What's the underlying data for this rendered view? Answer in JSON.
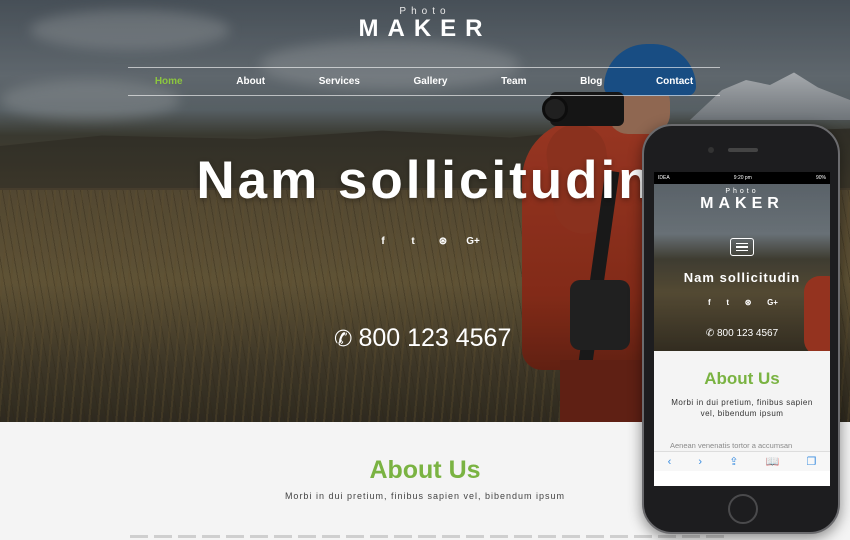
{
  "header": {
    "logo_small": "Photo",
    "logo_big": "MAKER",
    "nav": [
      {
        "label": "Home",
        "active": true
      },
      {
        "label": "About",
        "active": false
      },
      {
        "label": "Services",
        "active": false
      },
      {
        "label": "Gallery",
        "active": false
      },
      {
        "label": "Team",
        "active": false
      },
      {
        "label": "Blog",
        "active": false
      },
      {
        "label": "Contact",
        "active": false
      }
    ]
  },
  "hero": {
    "title": "Nam sollicitudin",
    "socials": [
      {
        "icon": "facebook-icon",
        "glyph": "f"
      },
      {
        "icon": "twitter-icon",
        "glyph": "t"
      },
      {
        "icon": "dribbble-icon",
        "glyph": "⊛"
      },
      {
        "icon": "google-plus-icon",
        "glyph": "G+"
      }
    ],
    "phone": "800 123 4567",
    "phone_icon": "phone-icon"
  },
  "about": {
    "heading": "About Us",
    "subheading": "Morbi in dui pretium, finibus sapien vel, bibendum ipsum"
  },
  "mobile": {
    "status_carrier": "IDEA",
    "status_time": "9:20 pm",
    "status_battery": "90%",
    "logo_small": "Photo",
    "logo_big": "MAKER",
    "title": "Nam sollicitudin",
    "phone": "800 123 4567",
    "about_heading": "About Us",
    "about_sub": "Morbi in dui pretium, finibus sapien vel, bibendum ipsum",
    "about_body": "Aenean venenatis tortor a accumsan tincidunt. Pellentesque mollis",
    "toolbar": [
      "‹",
      "›",
      "⇪",
      "📖",
      "❐"
    ]
  },
  "colors": {
    "accent": "#8cc63f",
    "about_heading": "#7ab342",
    "ios_blue": "#3a8de0"
  }
}
